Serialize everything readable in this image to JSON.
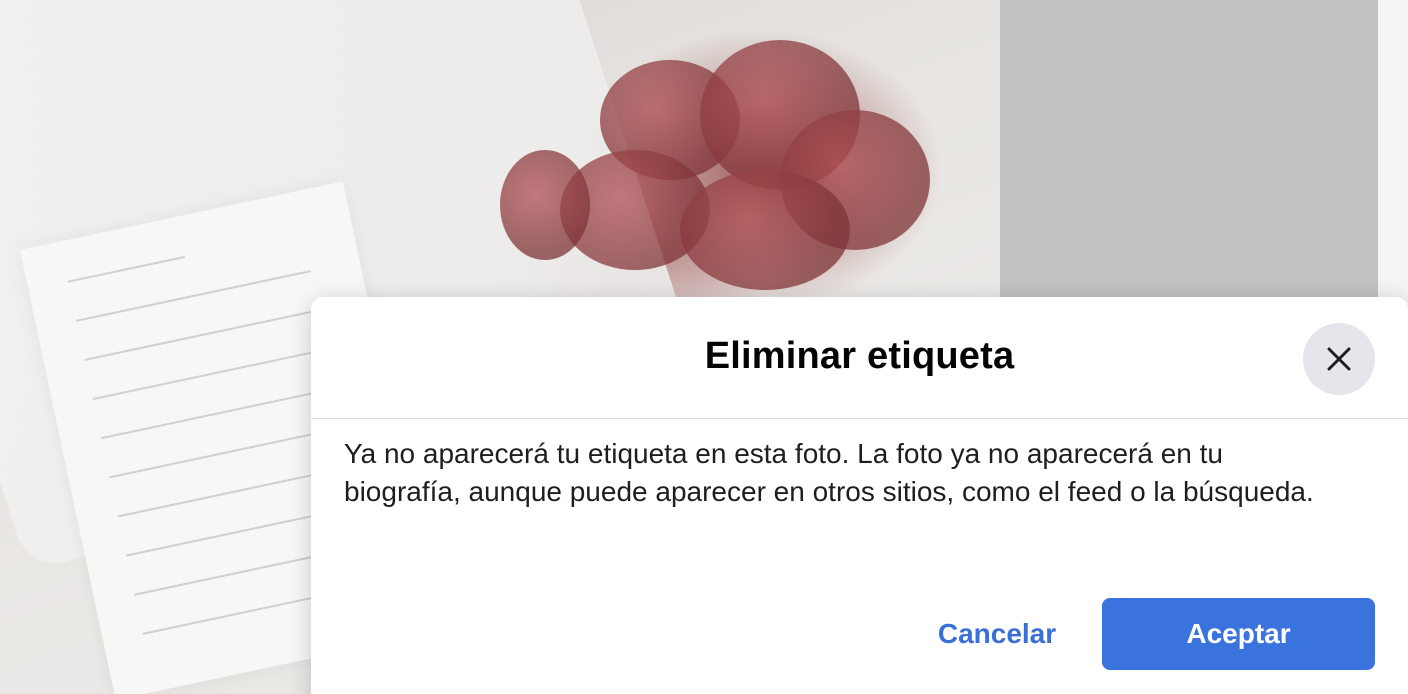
{
  "background": {
    "photo_icon": "photo-image",
    "panel_color": "#c2c2c2"
  },
  "dialog": {
    "title": "Eliminar etiqueta",
    "close_icon": "close-icon",
    "body": "Ya no aparecerá tu etiqueta en esta foto. La foto ya no aparecerá en tu biografía, aunque puede aparecer en otros sitios, como el feed o la búsqueda.",
    "cancel_label": "Cancelar",
    "accept_label": "Aceptar",
    "accent_color": "#3a72de"
  }
}
